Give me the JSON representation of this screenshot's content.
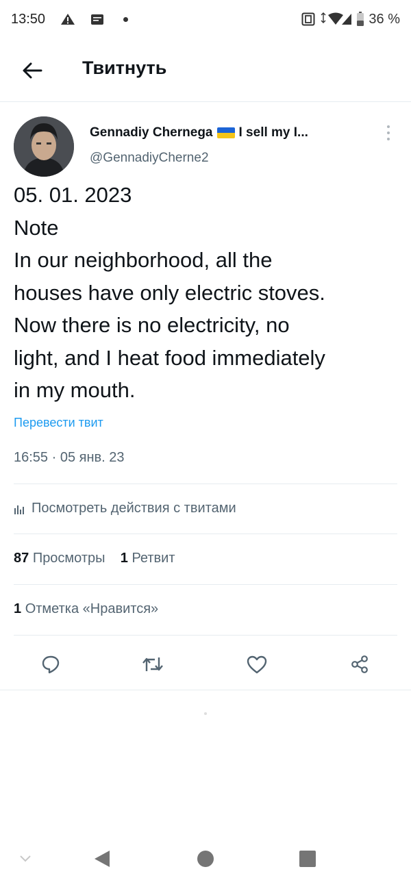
{
  "status_bar": {
    "time": "13:50",
    "battery": "36 %",
    "icons": [
      "warning-icon",
      "message-icon",
      "notification-dot",
      "data-icon",
      "wifi-icon",
      "signal-icon",
      "battery-icon"
    ]
  },
  "header": {
    "title": "Твитнуть",
    "back_icon": "arrow-left-icon"
  },
  "tweet": {
    "author_name": "Gennadiy Chernega",
    "author_bio_snippet": "I sell my I...",
    "handle": "@GennadiyCherne2",
    "body_lines": [
      "05. 01. 2023",
      "Note",
      "In our neighborhood, all the",
      "houses have only electric stoves.",
      "Now there is no electricity, no",
      "light, and I heat food immediately",
      "in my mouth."
    ],
    "translate_link": "Перевести твит",
    "timestamp": "16:55 · 05 янв. 23",
    "analytics_label": "Посмотреть действия с твитами",
    "views_count": "87",
    "views_label": "Просмотры",
    "retweets_count": "1",
    "retweets_label": "Ретвит",
    "likes_count": "1",
    "likes_label": "Отметка «Нравится»"
  },
  "actions": [
    "reply-icon",
    "retweet-icon",
    "like-icon",
    "share-icon"
  ],
  "colors": {
    "accent": "#1d9bf0",
    "text": "#0f1419",
    "secondary": "#536471",
    "flag_blue": "#1c64d6",
    "flag_yellow": "#f5c518"
  }
}
